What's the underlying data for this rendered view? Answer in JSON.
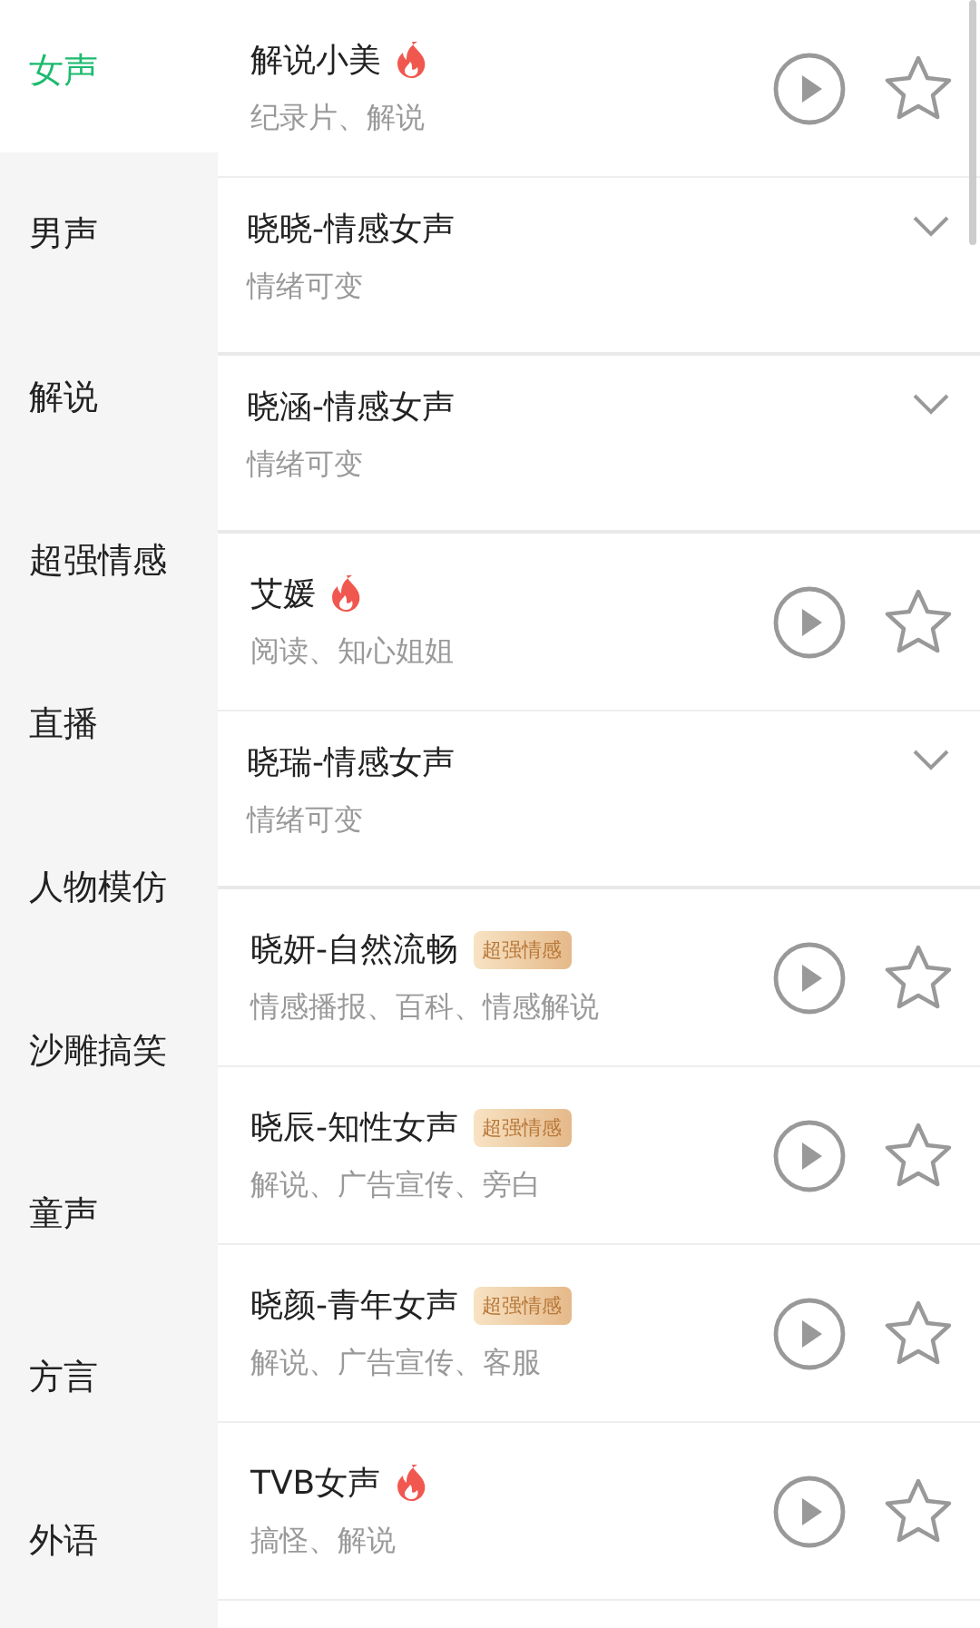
{
  "sidebar": {
    "items": [
      {
        "label": "女声",
        "selected": true
      },
      {
        "label": "男声",
        "selected": false
      },
      {
        "label": "解说",
        "selected": false
      },
      {
        "label": "超强情感",
        "selected": false
      },
      {
        "label": "直播",
        "selected": false
      },
      {
        "label": "人物模仿",
        "selected": false
      },
      {
        "label": "沙雕搞笑",
        "selected": false
      },
      {
        "label": "童声",
        "selected": false
      },
      {
        "label": "方言",
        "selected": false
      },
      {
        "label": "外语",
        "selected": false
      }
    ]
  },
  "voices": [
    {
      "kind": "voice",
      "name": "解说小美",
      "hot": true,
      "tags": "纪录片、解说"
    },
    {
      "kind": "group",
      "name": "晓晓-情感女声",
      "tags": "情绪可变",
      "expanded": false
    },
    {
      "kind": "group",
      "name": "晓涵-情感女声",
      "tags": "情绪可变",
      "expanded": false
    },
    {
      "kind": "voice",
      "name": "艾媛",
      "hot": true,
      "tags": "阅读、知心姐姐"
    },
    {
      "kind": "group",
      "name": "晓瑞-情感女声",
      "tags": "情绪可变",
      "expanded": false
    },
    {
      "kind": "voice",
      "name": "晓妍-自然流畅",
      "hot": false,
      "badge": "超强情感",
      "tags": "情感播报、百科、情感解说"
    },
    {
      "kind": "voice",
      "name": "晓辰-知性女声",
      "hot": false,
      "badge": "超强情感",
      "tags": "解说、广告宣传、旁白"
    },
    {
      "kind": "voice",
      "name": "晓颜-青年女声",
      "hot": false,
      "badge": "超强情感",
      "tags": "解说、广告宣传、客服"
    },
    {
      "kind": "voice",
      "name": "TVB女声",
      "hot": true,
      "tags": "搞怪、解说"
    }
  ]
}
